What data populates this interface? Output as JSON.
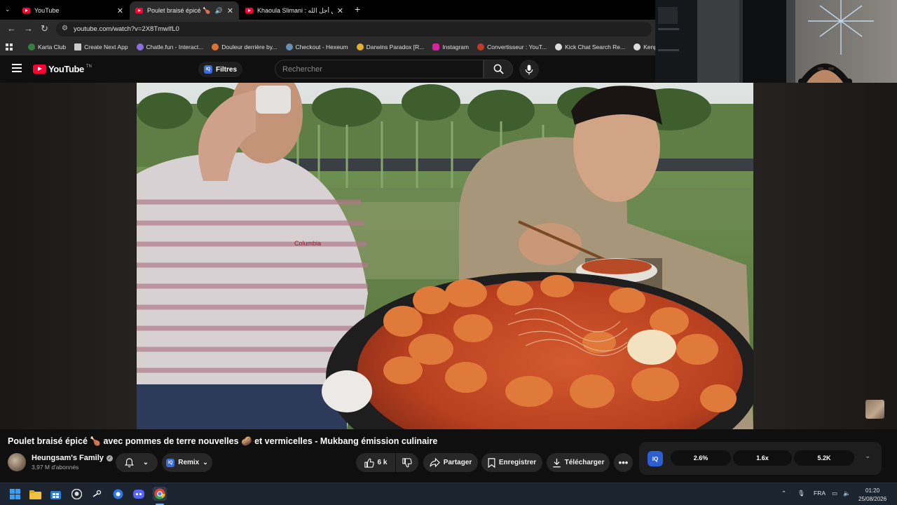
{
  "browser": {
    "tabs": [
      {
        "label": "YouTube",
        "active": false
      },
      {
        "label": "Poulet braisé épicé 🍗 avec",
        "active": true
      },
      {
        "label": "Khaoula Slimani : كاري من أجل الله",
        "active": false
      }
    ],
    "new_tab": "+",
    "url": "youtube.com/watch?v=2X8TmwIfL0",
    "bookmarks": [
      {
        "label": "Karta Club",
        "color": "#3a7d44"
      },
      {
        "label": "Create Next App",
        "color": "#cccccc"
      },
      {
        "label": "Chatle.fun - Interact...",
        "color": "#8f6fe0"
      },
      {
        "label": "Douleur derrière by...",
        "color": "#e07030"
      },
      {
        "label": "Checkout - Hexeum",
        "color": "#6a8fb0"
      },
      {
        "label": "Darwins Paradox [R...",
        "color": "#e0b030"
      },
      {
        "label": "Instagram",
        "color": "#d6249f"
      },
      {
        "label": "Convertisseur : YouT...",
        "color": "#c0392b"
      },
      {
        "label": "Kick Chat Search Re...",
        "color": "#dddddd"
      },
      {
        "label": "Kenpachi Zaraki Bl...",
        "color": "#dddddd"
      }
    ]
  },
  "youtube": {
    "logo_text": "YouTube",
    "logo_country": "TN",
    "filters_label": "Filtres",
    "search_placeholder": "Rechercher"
  },
  "video": {
    "title": "Poulet braisé épicé 🍗 avec pommes de terre nouvelles 🥔 et vermicelles - Mukbang émission culinaire",
    "channel": "Heungsam's Family",
    "subscribers": "3,97 M d'abonnés",
    "remix_label": "Remix",
    "likes": "6 k",
    "share_label": "Partager",
    "save_label": "Enregistrer",
    "download_label": "Télécharger"
  },
  "stats": [
    "2.6%",
    "1.6x",
    "5.2K"
  ],
  "taskbar": {
    "language": "FRA",
    "time": "01:20",
    "date": "25/08/2026"
  }
}
